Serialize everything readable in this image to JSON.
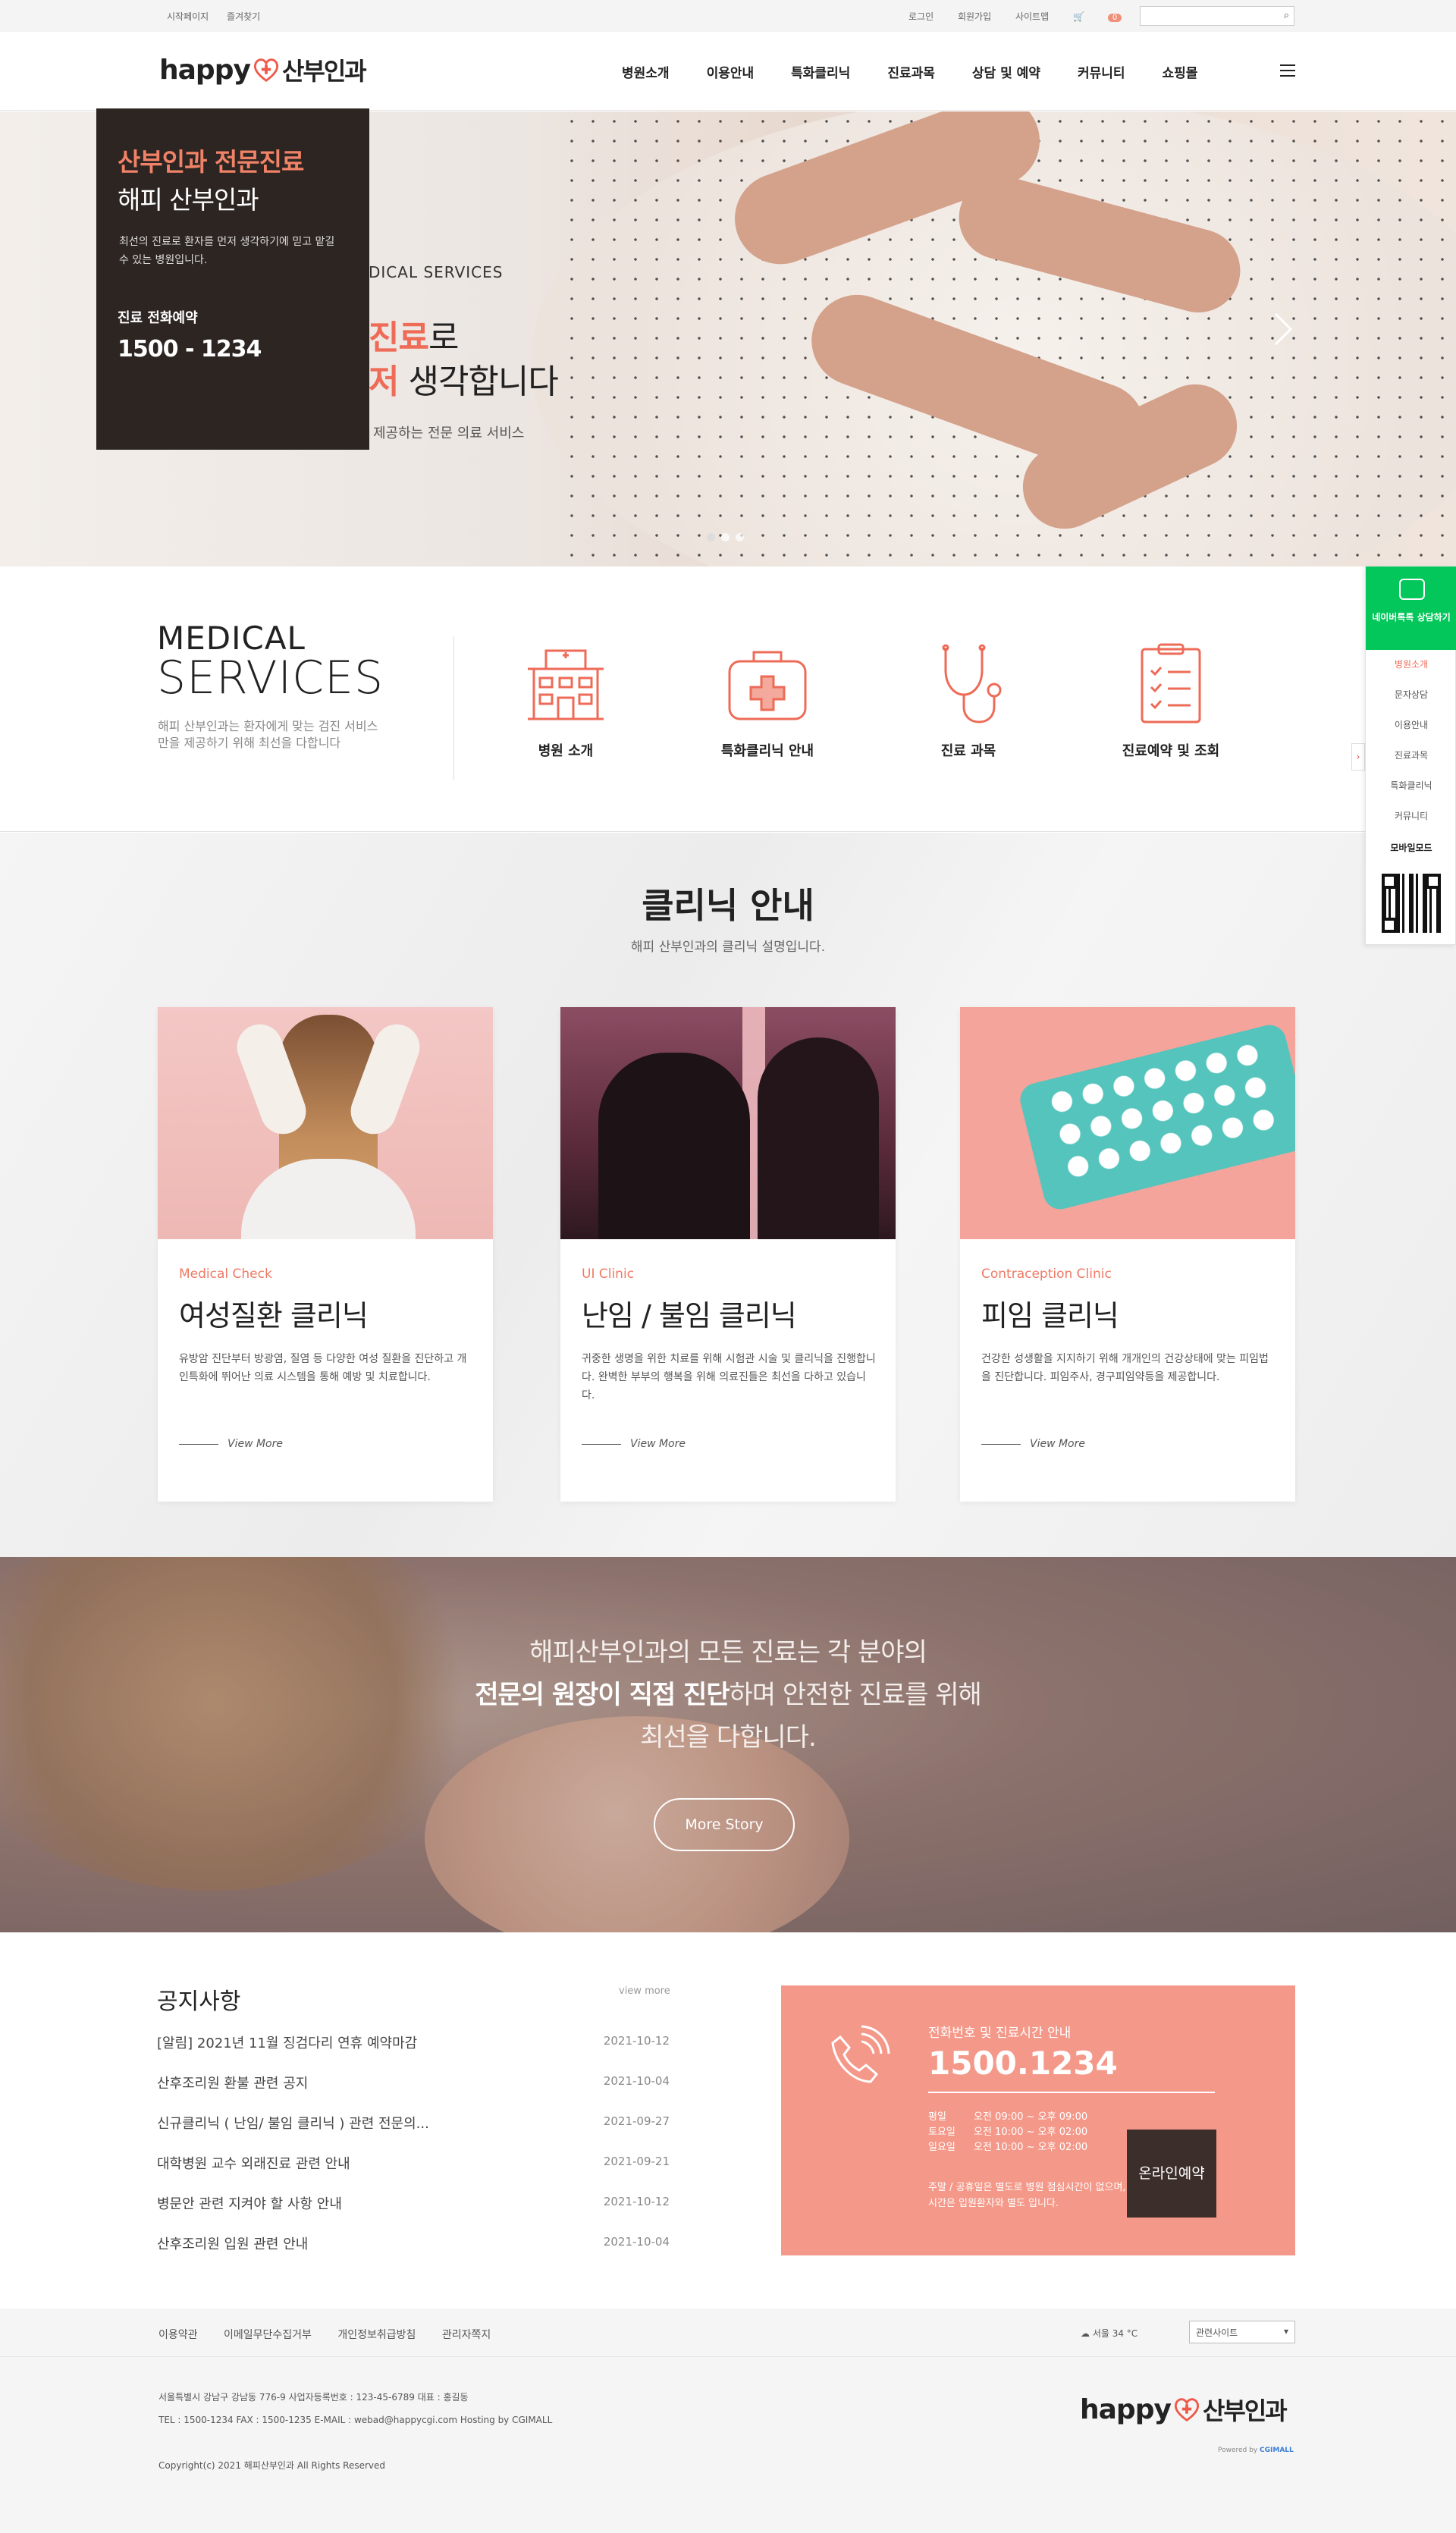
{
  "topbar": {
    "left": [
      "시작페이지",
      "즐겨찾기"
    ],
    "right": [
      "로그인",
      "회원가입",
      "사이트맵"
    ],
    "cart_count": "0"
  },
  "logo": {
    "en": "happy",
    "kr": "산부인과"
  },
  "gnb": [
    "병원소개",
    "이용안내",
    "특화클리닉",
    "진료과목",
    "상담 및 예약",
    "커뮤니티",
    "쇼핑몰"
  ],
  "hero": {
    "eyebrow": "DICAL SERVICES",
    "line1_accent": "진료",
    "line1_rest": "로",
    "line2_accent": "저",
    "line2_rest": " 생각합니다",
    "sub": "제공하는 전문 의료 서비스",
    "card": {
      "title_accent": "산부인과 전문진료",
      "title": "해피 산부인과",
      "desc": "최선의 진료로 환자를 먼저 생각하기에 믿고 맡길 수 있는 병원입니다.",
      "phone_label": "진료 전화예약",
      "phone": "1500 - 1234"
    }
  },
  "services": {
    "title1": "MEDICAL",
    "title2": "SERVICES",
    "desc": "해피 산부인과는 환자에게 맞는 검진 서비스만을 제공하기 위해 최선을 다합니다",
    "items": [
      {
        "label": "병원 소개",
        "icon": "hospital-icon"
      },
      {
        "label": "특화클리닉 안내",
        "icon": "first-aid-kit-icon"
      },
      {
        "label": "진료 과목",
        "icon": "stethoscope-icon"
      },
      {
        "label": "진료예약 및 조회",
        "icon": "clipboard-icon"
      }
    ]
  },
  "clinic": {
    "title": "클리닉 안내",
    "subtitle": "해피 산부인과의 클리닉 설명입니다.",
    "cards": [
      {
        "category": "Medical Check",
        "title": "여성질환 클리닉",
        "desc": "유방암 진단부터 방광염, 질염 등 다양한 여성 질환을 진단하고 개인특화에 뛰어난 의료 시스템을 통해 예방 및 치료합니다.",
        "more": "View More"
      },
      {
        "category": "UI Clinic",
        "title": "난임 / 불임 클리닉",
        "desc": "귀중한 생명을 위한 치료를 위해 시험관 시술 및 클리닉을 진행합니다. 완벽한 부부의 행복을 위해 의료진들은 최선을 다하고 있습니다.",
        "more": "View More"
      },
      {
        "category": "Contraception Clinic",
        "title": "피임 클리닉",
        "desc": "건강한 성생활을 지지하기 위해 개개인의 건강상태에 맞는 피임법을 진단합니다. 피임주사, 경구피임약등을 제공합니다.",
        "more": "View More"
      }
    ]
  },
  "banner": {
    "line1": "해피산부인과의 모든 진료는 각 분야의",
    "line2_bold": "전문의 원장이 직접 진단",
    "line2_rest": "하며 안전한 진료를 위해",
    "line3": "최선을 다합니다.",
    "button": "More Story"
  },
  "notice": {
    "title": "공지사항",
    "more": "view more",
    "items": [
      {
        "title": "[알림] 2021년 11월 징검다리 연휴 예약마감",
        "date": "2021-10-12"
      },
      {
        "title": "산후조리원 환불 관련 공지",
        "date": "2021-10-04"
      },
      {
        "title": "신규클리닉 ( 난임/ 불임 클리닉 ) 관련 전문의...",
        "date": "2021-09-27"
      },
      {
        "title": "대학병원 교수 외래진료 관련 안내",
        "date": "2021-09-21"
      },
      {
        "title": "병문안 관련 지켜야 할 사항 안내",
        "date": "2021-10-12"
      },
      {
        "title": "산후조리원 입원 관련 안내",
        "date": "2021-10-04"
      }
    ]
  },
  "contact": {
    "label": "전화번호 및 진료시간 안내",
    "phone": "1500.1234",
    "hours": [
      {
        "day": "평일",
        "time": "오전 09:00 ~ 오후 09:00"
      },
      {
        "day": "토요일",
        "time": "오전 10:00 ~ 오후 02:00"
      },
      {
        "day": "일요일",
        "time": "오전 10:00 ~ 오후 02:00"
      }
    ],
    "note": "주말 / 공휴일은 별도로 병원 점심시간이 없으며, 진료시간은 입원환자와 별도 입니다.",
    "online_button": "온라인예약"
  },
  "footer": {
    "links": [
      "이용약관",
      "이메일무단수집거부",
      "개인정보취급방침",
      "관리자쪽지"
    ],
    "weather": "서울 34 °C",
    "related_site": "관련사이트",
    "address": "서울특별시 강남구 강남동 776-9    사업자등록번호 : 123-45-6789    대표 : 홍길동",
    "contact": "TEL : 1500-1234    FAX : 1500-1235    E-MAIL : webad@happycgi.com    Hosting by CGIMALL",
    "copyright": "Copyright(c) 2021 해피산부인과 All Rights Reserved",
    "powered": "Powered by",
    "powered_brand": "CGIMALL"
  },
  "quick": {
    "talk": "네이버톡톡 상담하기",
    "items": [
      "병원소개",
      "문자상담",
      "이용안내",
      "진료과목",
      "특화클리닉",
      "커뮤니티"
    ],
    "mobile": "모바일모드"
  },
  "colors": {
    "accent": "#ee6b57",
    "contact_bg": "#f4998a",
    "talk_green": "#03c75a"
  }
}
